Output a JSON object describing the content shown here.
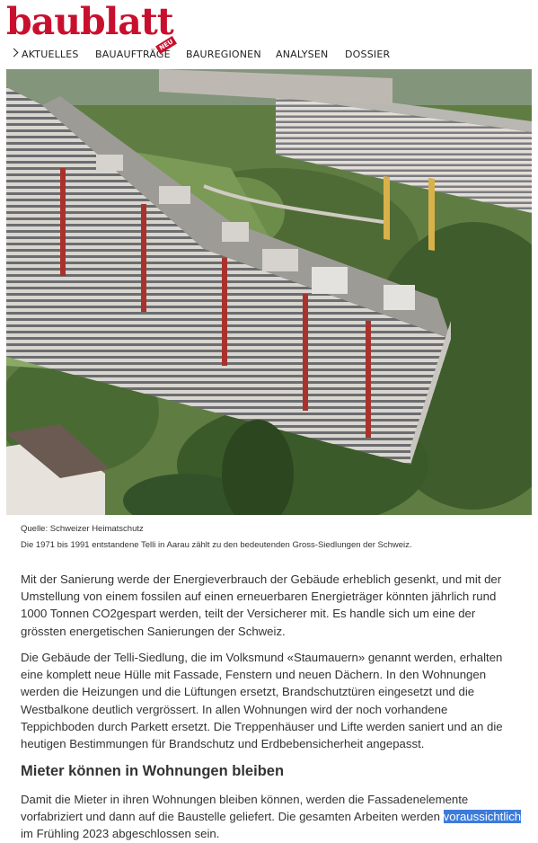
{
  "header": {
    "logo": "baublatt",
    "nav": [
      {
        "label": "AKTUELLES"
      },
      {
        "label": "BAUAUFTRÄGE"
      },
      {
        "label": "BAUREGIONEN"
      },
      {
        "label": "ANALYSEN"
      },
      {
        "label": "DOSSIER"
      }
    ],
    "new_badge": "NEU"
  },
  "photo": {
    "subject": "aerial photo of Telli housing blocks",
    "credit": "Quelle: Schweizer Heimatschutz",
    "caption": "Die 1971 bis 1991 entstandene Telli in Aarau zählt zu den bedeutenden Gross-Siedlungen der Schweiz."
  },
  "article": {
    "para1": "Mit der Sanierung werde der Energieverbrauch der Gebäude erheblich gesenkt, und mit der Umstellung von einem fossilen auf einen erneuerbaren Energieträger könnten jährlich rund 1000 Tonnen CO2gespart werden, teilt der Versicherer mit. Es handle sich um eine der grössten energetischen Sanierungen der Schweiz.",
    "para2": "Die Gebäude der Telli-Siedlung, die im Volksmund «Staumauern» genannt werden, erhalten eine komplett neue Hülle mit Fassade, Fenstern und neuen Dächern. In den Wohnungen werden die Heizungen und die Lüftungen ersetzt, Brandschutztüren eingesetzt und die Westbalkone deutlich vergrössert. In allen Wohnungen wird der noch vorhandene Teppichboden durch Parkett ersetzt. Die Treppenhäuser und Lifte werden saniert und an die heutigen Bestimmungen für Brandschutz und Erdbebensicherheit angepasst.",
    "subheading": "Mieter können in Wohnungen bleiben",
    "para3_before": "Damit die Mieter in ihren Wohnungen bleiben können, werden die Fassadenelemente vorfabriziert und dann auf die Baustelle geliefert. Die gesamten Arbeiten werden ",
    "para3_highlight": "voraussichtlich",
    "para3_after": " im Frühling 2023 abgeschlossen sein."
  },
  "colors": {
    "brand": "#c8102e",
    "text": "#333333",
    "selection": "#3d7bd9"
  }
}
